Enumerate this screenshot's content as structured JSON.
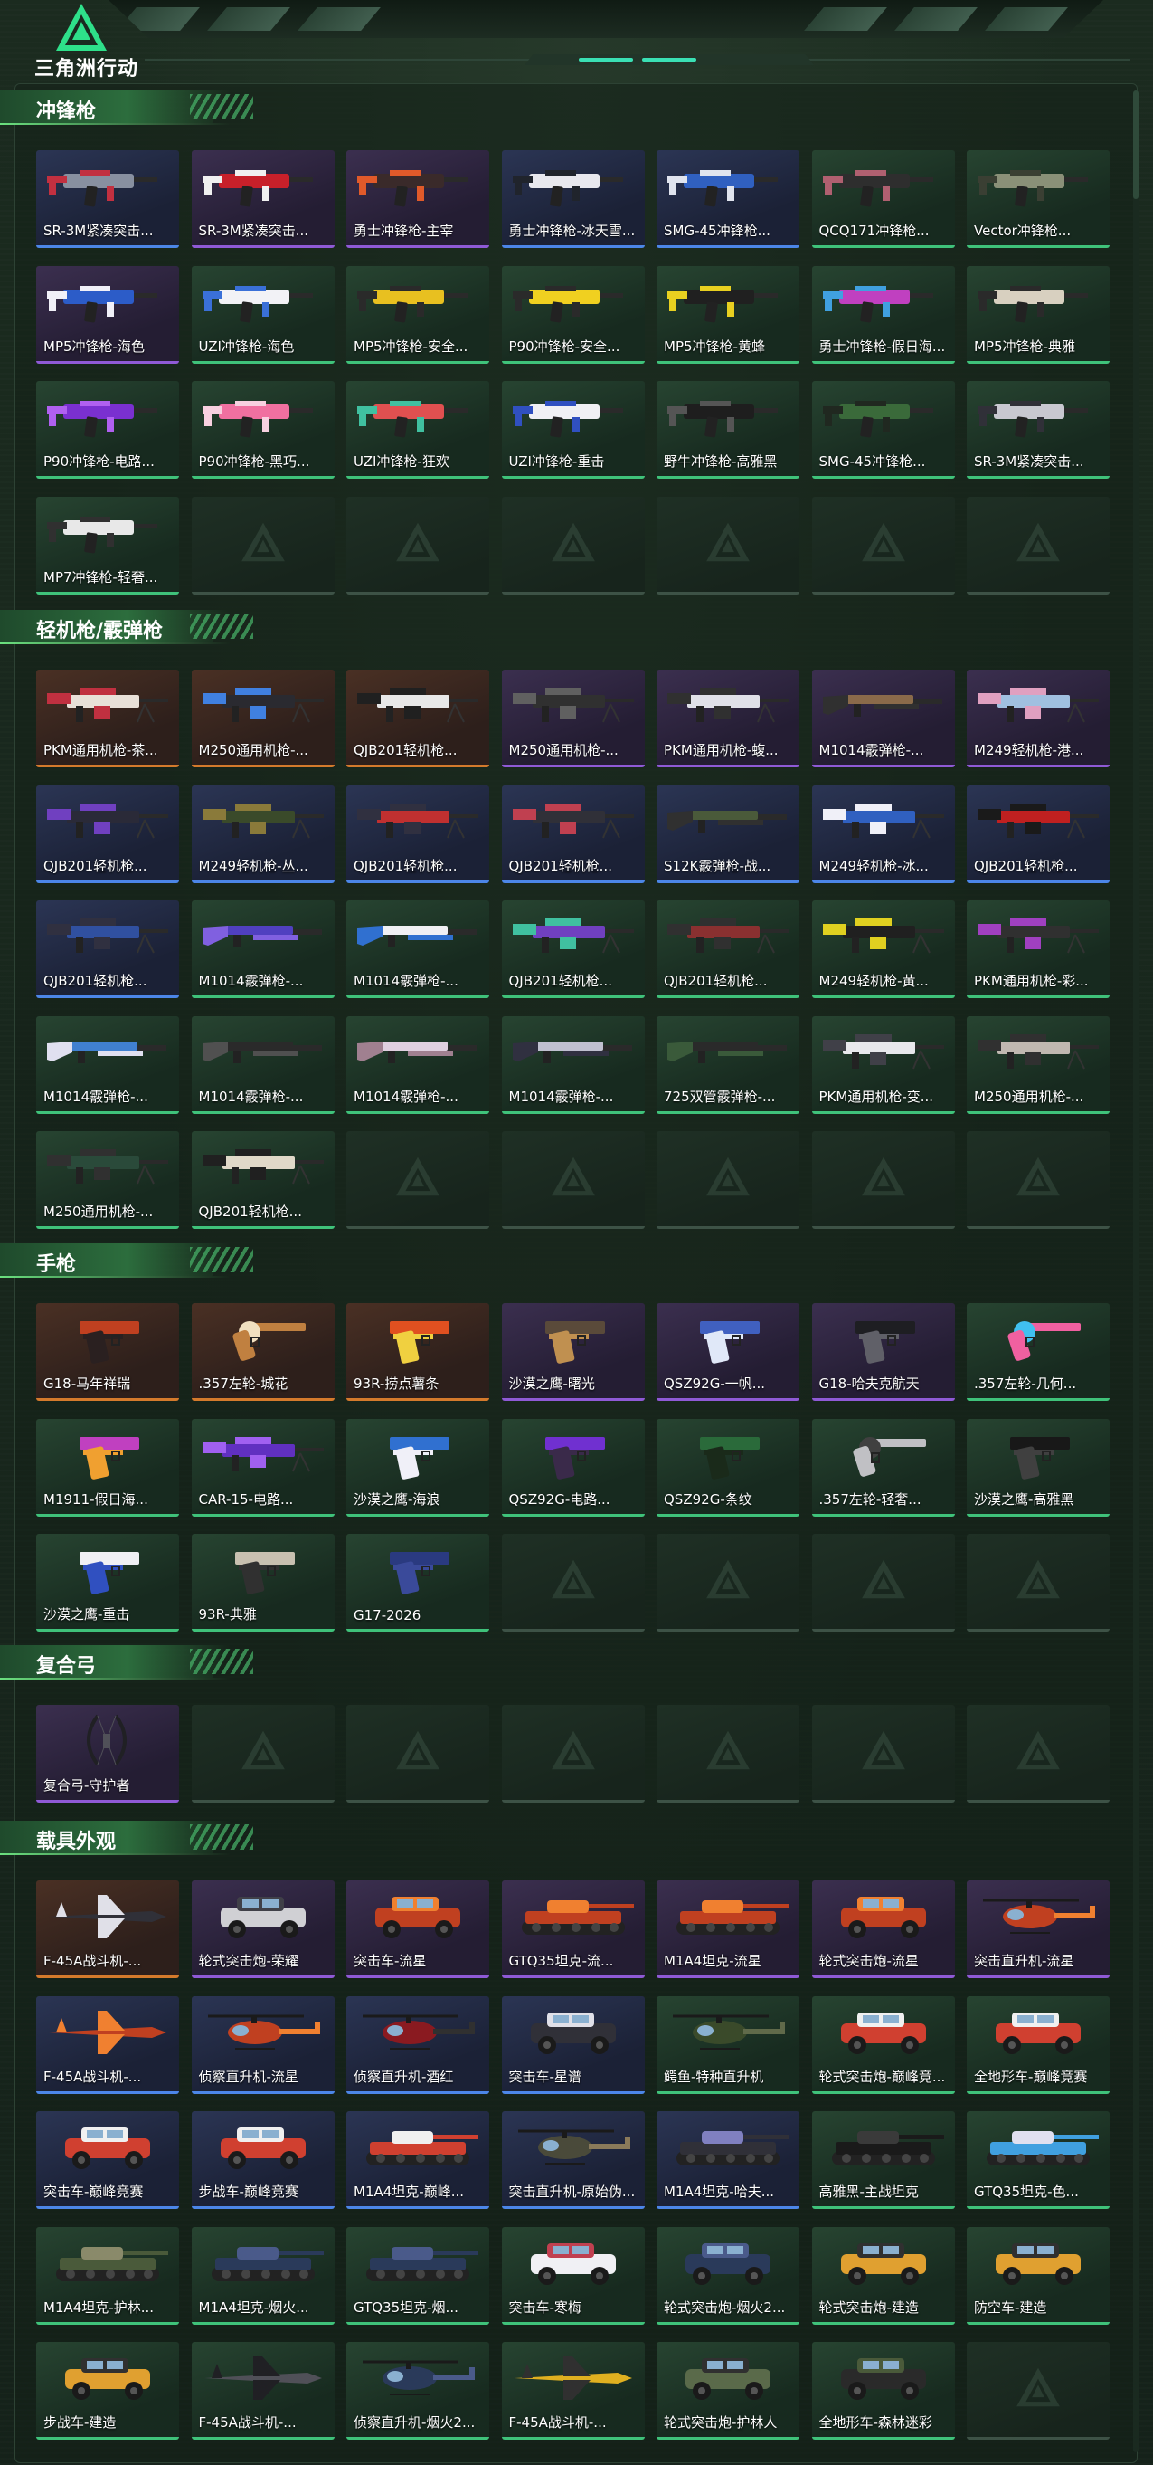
{
  "header": {
    "logo_text": "三角洲行动"
  },
  "colors": {
    "gold": "#d47a2c",
    "purple": "#8f5ad6",
    "blue": "#4c86e8",
    "green": "#3fc27a",
    "accent": "#6be07f"
  },
  "sections": [
    {
      "title": "冲锋枪",
      "category": "weapon",
      "items": [
        {
          "label": "SR-3M紧凑突击...",
          "rarity": "blue",
          "kind": "smg",
          "c1": "#8890a0",
          "c2": "#c23040"
        },
        {
          "label": "SR-3M紧凑突击...",
          "rarity": "purple",
          "kind": "smg",
          "c1": "#c8202a",
          "c2": "#f0f0f0"
        },
        {
          "label": "勇士冲锋枪-主宰",
          "rarity": "purple",
          "kind": "smg",
          "c1": "#3a2a2a",
          "c2": "#e05a2a"
        },
        {
          "label": "勇士冲锋枪-冰天雪...",
          "rarity": "blue",
          "kind": "smg",
          "c1": "#e8e8ee",
          "c2": "#20242c"
        },
        {
          "label": "SMG-45冲锋枪...",
          "rarity": "blue",
          "kind": "smg",
          "c1": "#3060c0",
          "c2": "#e0e4ee"
        },
        {
          "label": "QCQ171冲锋枪...",
          "rarity": "green",
          "kind": "smg",
          "c1": "#2e2e2e",
          "c2": "#b06070"
        },
        {
          "label": "Vector冲锋枪...",
          "rarity": "green",
          "kind": "smg",
          "c1": "#8a9078",
          "c2": "#3a3f33"
        },
        {
          "label": "MP5冲锋枪-海色",
          "rarity": "purple",
          "kind": "smg",
          "c1": "#2c5cc8",
          "c2": "#f0f0f8"
        },
        {
          "label": "UZI冲锋枪-海色",
          "rarity": "green",
          "kind": "smg",
          "c1": "#f2f2f6",
          "c2": "#3a70d8"
        },
        {
          "label": "MP5冲锋枪-安全...",
          "rarity": "green",
          "kind": "smg",
          "c1": "#e8c020",
          "c2": "#2a2a2a"
        },
        {
          "label": "P90冲锋枪-安全...",
          "rarity": "green",
          "kind": "smg",
          "c1": "#f0d020",
          "c2": "#2a2a2a"
        },
        {
          "label": "MP5冲锋枪-黄蜂",
          "rarity": "green",
          "kind": "smg",
          "c1": "#202020",
          "c2": "#e8d020"
        },
        {
          "label": "勇士冲锋枪-假日海...",
          "rarity": "green",
          "kind": "smg",
          "c1": "#c040c0",
          "c2": "#40a0e0"
        },
        {
          "label": "MP5冲锋枪-典雅",
          "rarity": "green",
          "kind": "smg",
          "c1": "#d8d0c0",
          "c2": "#2a2a2a"
        },
        {
          "label": "P90冲锋枪-电路...",
          "rarity": "green",
          "kind": "smg",
          "c1": "#7a30d0",
          "c2": "#b060f0"
        },
        {
          "label": "P90冲锋枪-黑巧...",
          "rarity": "green",
          "kind": "smg",
          "c1": "#f070a0",
          "c2": "#f8d0e0"
        },
        {
          "label": "UZI冲锋枪-狂欢",
          "rarity": "green",
          "kind": "smg",
          "c1": "#e05050",
          "c2": "#40c0a0"
        },
        {
          "label": "UZI冲锋枪-重击",
          "rarity": "green",
          "kind": "smg",
          "c1": "#f0f0f4",
          "c2": "#3050c0"
        },
        {
          "label": "野牛冲锋枪-高雅黑",
          "rarity": "green",
          "kind": "smg",
          "c1": "#1e1e1e",
          "c2": "#555555"
        },
        {
          "label": "SMG-45冲锋枪...",
          "rarity": "green",
          "kind": "smg",
          "c1": "#3a6a3a",
          "c2": "#202820"
        },
        {
          "label": "SR-3M紧凑突击...",
          "rarity": "green",
          "kind": "smg",
          "c1": "#c8c8d0",
          "c2": "#303038"
        },
        {
          "label": "MP7冲锋枪-轻奢...",
          "rarity": "green",
          "kind": "smg",
          "c1": "#e8e8e8",
          "c2": "#303030"
        },
        {
          "label": "",
          "rarity": "empty"
        },
        {
          "label": "",
          "rarity": "empty"
        },
        {
          "label": "",
          "rarity": "empty"
        },
        {
          "label": "",
          "rarity": "empty"
        },
        {
          "label": "",
          "rarity": "empty"
        },
        {
          "label": "",
          "rarity": "empty"
        }
      ]
    },
    {
      "title": "轻机枪/霰弹枪",
      "category": "weapon",
      "items": [
        {
          "label": "PKM通用机枪-茶...",
          "rarity": "gold",
          "kind": "lmg",
          "c1": "#e8e0d8",
          "c2": "#c03040"
        },
        {
          "label": "M250通用机枪-...",
          "rarity": "gold",
          "kind": "lmg",
          "c1": "#2a2a30",
          "c2": "#4080e0"
        },
        {
          "label": "QJB201轻机枪...",
          "rarity": "gold",
          "kind": "lmg",
          "c1": "#e8e8e8",
          "c2": "#202020"
        },
        {
          "label": "M250通用机枪-...",
          "rarity": "purple",
          "kind": "lmg",
          "c1": "#303030",
          "c2": "#606060"
        },
        {
          "label": "PKM通用机枪-蝮...",
          "rarity": "purple",
          "kind": "lmg",
          "c1": "#e0e0e8",
          "c2": "#303030"
        },
        {
          "label": "M1014霰弹枪-...",
          "rarity": "purple",
          "kind": "shotgun",
          "c1": "#8a6a4a",
          "c2": "#303030"
        },
        {
          "label": "M249轻机枪-港...",
          "rarity": "purple",
          "kind": "lmg",
          "c1": "#a0c0e0",
          "c2": "#e0a0c0"
        },
        {
          "label": "QJB201轻机枪...",
          "rarity": "blue",
          "kind": "lmg",
          "c1": "#2a2a38",
          "c2": "#7040c0"
        },
        {
          "label": "M249轻机枪-丛...",
          "rarity": "blue",
          "kind": "lmg",
          "c1": "#3a4a2a",
          "c2": "#8a7a3a"
        },
        {
          "label": "QJB201轻机枪...",
          "rarity": "blue",
          "kind": "lmg",
          "c1": "#c03030",
          "c2": "#303040"
        },
        {
          "label": "QJB201轻机枪...",
          "rarity": "blue",
          "kind": "lmg",
          "c1": "#303038",
          "c2": "#c04050"
        },
        {
          "label": "S12K霰弹枪-战...",
          "rarity": "blue",
          "kind": "shotgun",
          "c1": "#4a5a3a",
          "c2": "#303030"
        },
        {
          "label": "M249轻机枪-冰...",
          "rarity": "blue",
          "kind": "lmg",
          "c1": "#3060c0",
          "c2": "#f0f0f8"
        },
        {
          "label": "QJB201轻机枪...",
          "rarity": "blue",
          "kind": "lmg",
          "c1": "#c02020",
          "c2": "#1a1a1a"
        },
        {
          "label": "QJB201轻机枪...",
          "rarity": "blue",
          "kind": "lmg",
          "c1": "#3050a0",
          "c2": "#303040"
        },
        {
          "label": "M1014霰弹枪-...",
          "rarity": "green",
          "kind": "shotgun",
          "c1": "#5040c0",
          "c2": "#8060e0"
        },
        {
          "label": "M1014霰弹枪-...",
          "rarity": "green",
          "kind": "shotgun",
          "c1": "#f0f0f4",
          "c2": "#3070d0"
        },
        {
          "label": "QJB201轻机枪...",
          "rarity": "green",
          "kind": "lmg",
          "c1": "#7040c0",
          "c2": "#40c0a0"
        },
        {
          "label": "QJB201轻机枪...",
          "rarity": "green",
          "kind": "lmg",
          "c1": "#8a3030",
          "c2": "#303030"
        },
        {
          "label": "M249轻机枪-黄...",
          "rarity": "green",
          "kind": "lmg",
          "c1": "#202020",
          "c2": "#e0d020"
        },
        {
          "label": "PKM通用机枪-彩...",
          "rarity": "green",
          "kind": "lmg",
          "c1": "#303030",
          "c2": "#a040c0"
        },
        {
          "label": "M1014霰弹枪-...",
          "rarity": "green",
          "kind": "shotgun",
          "c1": "#4080d0",
          "c2": "#e0e0f0"
        },
        {
          "label": "M1014霰弹枪-...",
          "rarity": "green",
          "kind": "shotgun",
          "c1": "#2a2a2a",
          "c2": "#505050"
        },
        {
          "label": "M1014霰弹枪-...",
          "rarity": "green",
          "kind": "shotgun",
          "c1": "#e0d0e0",
          "c2": "#a08090"
        },
        {
          "label": "M1014霰弹枪-...",
          "rarity": "green",
          "kind": "shotgun",
          "c1": "#c0c0d0",
          "c2": "#303040"
        },
        {
          "label": "725双管霰弹枪-...",
          "rarity": "green",
          "kind": "shotgun",
          "c1": "#2a2a2a",
          "c2": "#3a5a3a"
        },
        {
          "label": "PKM通用机枪-变...",
          "rarity": "green",
          "kind": "lmg",
          "c1": "#e8e8ec",
          "c2": "#404048"
        },
        {
          "label": "M250通用机枪-...",
          "rarity": "green",
          "kind": "lmg",
          "c1": "#c0b8b0",
          "c2": "#303030"
        },
        {
          "label": "M250通用机枪-...",
          "rarity": "green",
          "kind": "lmg",
          "c1": "#2a4a3a",
          "c2": "#303030"
        },
        {
          "label": "QJB201轻机枪...",
          "rarity": "green",
          "kind": "lmg",
          "c1": "#e0d8c8",
          "c2": "#202020"
        },
        {
          "label": "",
          "rarity": "empty"
        },
        {
          "label": "",
          "rarity": "empty"
        },
        {
          "label": "",
          "rarity": "empty"
        },
        {
          "label": "",
          "rarity": "empty"
        },
        {
          "label": "",
          "rarity": "empty"
        }
      ]
    },
    {
      "title": "手枪",
      "category": "weapon",
      "items": [
        {
          "label": "G18-马年祥瑞",
          "rarity": "gold",
          "kind": "pistol",
          "c1": "#c04020",
          "c2": "#2a2020"
        },
        {
          "label": ".357左轮-城花",
          "rarity": "gold",
          "kind": "revolver",
          "c1": "#c08040",
          "c2": "#f0e0c0"
        },
        {
          "label": "93R-捞点薯条",
          "rarity": "gold",
          "kind": "pistol",
          "c1": "#e05020",
          "c2": "#f0d040"
        },
        {
          "label": "沙漠之鹰-曙光",
          "rarity": "purple",
          "kind": "pistol",
          "c1": "#5a4a3a",
          "c2": "#c09050"
        },
        {
          "label": "QSZ92G-一帆...",
          "rarity": "purple",
          "kind": "pistol",
          "c1": "#4060c0",
          "c2": "#e0e8f8"
        },
        {
          "label": "G18-哈夫克航天",
          "rarity": "purple",
          "kind": "pistol",
          "c1": "#1e1e22",
          "c2": "#606068"
        },
        {
          "label": ".357左轮-几何...",
          "rarity": "green",
          "kind": "revolver",
          "c1": "#f060a0",
          "c2": "#40c0f0"
        },
        {
          "label": "M1911-假日海...",
          "rarity": "green",
          "kind": "pistol",
          "c1": "#c040c0",
          "c2": "#f0a030"
        },
        {
          "label": "CAR-15-电路...",
          "rarity": "green",
          "kind": "lmg",
          "c1": "#6030c0",
          "c2": "#a060f0"
        },
        {
          "label": "沙漠之鹰-海浪",
          "rarity": "green",
          "kind": "pistol",
          "c1": "#3070d0",
          "c2": "#f0f0f8"
        },
        {
          "label": "QSZ92G-电路...",
          "rarity": "green",
          "kind": "pistol",
          "c1": "#7030d0",
          "c2": "#3a2a4a"
        },
        {
          "label": "QSZ92G-条纹",
          "rarity": "green",
          "kind": "pistol",
          "c1": "#2a6a3a",
          "c2": "#1a2a1a"
        },
        {
          "label": ".357左轮-轻奢...",
          "rarity": "green",
          "kind": "revolver",
          "c1": "#c0c0c4",
          "c2": "#404040"
        },
        {
          "label": "沙漠之鹰-高雅黑",
          "rarity": "green",
          "kind": "pistol",
          "c1": "#181818",
          "c2": "#404040"
        },
        {
          "label": "沙漠之鹰-重击",
          "rarity": "green",
          "kind": "pistol",
          "c1": "#f0f0f4",
          "c2": "#3050c0"
        },
        {
          "label": "93R-典雅",
          "rarity": "green",
          "kind": "pistol",
          "c1": "#c8c0b0",
          "c2": "#303030"
        },
        {
          "label": "G17-2026",
          "rarity": "green",
          "kind": "pistol",
          "c1": "#2a3a80",
          "c2": "#3a4a9a"
        },
        {
          "label": "",
          "rarity": "empty"
        },
        {
          "label": "",
          "rarity": "empty"
        },
        {
          "label": "",
          "rarity": "empty"
        },
        {
          "label": "",
          "rarity": "empty"
        }
      ]
    },
    {
      "title": "复合弓",
      "category": "weapon",
      "items": [
        {
          "label": "复合弓-守护者",
          "rarity": "purple",
          "kind": "bow",
          "c1": "#202024",
          "c2": "#505058"
        },
        {
          "label": "",
          "rarity": "empty"
        },
        {
          "label": "",
          "rarity": "empty"
        },
        {
          "label": "",
          "rarity": "empty"
        },
        {
          "label": "",
          "rarity": "empty"
        },
        {
          "label": "",
          "rarity": "empty"
        },
        {
          "label": "",
          "rarity": "empty"
        }
      ]
    },
    {
      "title": "载具外观",
      "category": "vehicle",
      "items": [
        {
          "label": "F-45A战斗机-...",
          "rarity": "gold",
          "kind": "jet",
          "c1": "#303038",
          "c2": "#e0e0e8"
        },
        {
          "label": "轮式突击炮-荣耀",
          "rarity": "purple",
          "kind": "car",
          "c1": "#d0d0d4",
          "c2": "#404048"
        },
        {
          "label": "突击车-流星",
          "rarity": "purple",
          "kind": "car",
          "c1": "#c04020",
          "c2": "#f08030"
        },
        {
          "label": "GTQ35坦克-流...",
          "rarity": "purple",
          "kind": "tank",
          "c1": "#c04020",
          "c2": "#f08030"
        },
        {
          "label": "M1A4坦克-流星",
          "rarity": "purple",
          "kind": "tank",
          "c1": "#c04020",
          "c2": "#f08030"
        },
        {
          "label": "轮式突击炮-流星",
          "rarity": "purple",
          "kind": "car",
          "c1": "#c04020",
          "c2": "#f08030"
        },
        {
          "label": "突击直升机-流星",
          "rarity": "purple",
          "kind": "heli",
          "c1": "#c04020",
          "c2": "#f08030"
        },
        {
          "label": "F-45A战斗机-...",
          "rarity": "blue",
          "kind": "jet",
          "c1": "#c04020",
          "c2": "#f08030"
        },
        {
          "label": "侦察直升机-流星",
          "rarity": "blue",
          "kind": "heli",
          "c1": "#c04020",
          "c2": "#f08030"
        },
        {
          "label": "侦察直升机-酒红",
          "rarity": "blue",
          "kind": "heli",
          "c1": "#8a1a20",
          "c2": "#303030"
        },
        {
          "label": "突击车-星谱",
          "rarity": "blue",
          "kind": "car",
          "c1": "#303038",
          "c2": "#e0e0e8"
        },
        {
          "label": "鳄鱼-特种直升机",
          "rarity": "green",
          "kind": "heli",
          "c1": "#3a4a2a",
          "c2": "#606a4a"
        },
        {
          "label": "轮式突击炮-巅峰竞...",
          "rarity": "green",
          "kind": "car",
          "c1": "#d04030",
          "c2": "#f0f0f0"
        },
        {
          "label": "全地形车-巅峰竞赛",
          "rarity": "green",
          "kind": "car",
          "c1": "#d04030",
          "c2": "#f0f0f0"
        },
        {
          "label": "突击车-巅峰竞赛",
          "rarity": "blue",
          "kind": "car",
          "c1": "#d04030",
          "c2": "#f0f0f0"
        },
        {
          "label": "步战车-巅峰竞赛",
          "rarity": "blue",
          "kind": "car",
          "c1": "#d04030",
          "c2": "#f0f0f0"
        },
        {
          "label": "M1A4坦克-巅峰...",
          "rarity": "blue",
          "kind": "tank",
          "c1": "#d04030",
          "c2": "#f0f0f0"
        },
        {
          "label": "突击直升机-原始伪...",
          "rarity": "blue",
          "kind": "heli",
          "c1": "#4a4a3a",
          "c2": "#8a7a5a"
        },
        {
          "label": "M1A4坦克-哈夫...",
          "rarity": "blue",
          "kind": "tank",
          "c1": "#303038",
          "c2": "#8080c0"
        },
        {
          "label": "高雅黑-主战坦克",
          "rarity": "green",
          "kind": "tank",
          "c1": "#1a1a1a",
          "c2": "#3a3a3a"
        },
        {
          "label": "GTQ35坦克-色...",
          "rarity": "green",
          "kind": "tank",
          "c1": "#40a0e0",
          "c2": "#e0e0f0"
        },
        {
          "label": "M1A4坦克-护林...",
          "rarity": "green",
          "kind": "tank",
          "c1": "#4a5a3a",
          "c2": "#8a8a6a"
        },
        {
          "label": "M1A4坦克-烟火...",
          "rarity": "green",
          "kind": "tank",
          "c1": "#2a3a5a",
          "c2": "#4a5a8a"
        },
        {
          "label": "GTQ35坦克-烟...",
          "rarity": "green",
          "kind": "tank",
          "c1": "#2a3a5a",
          "c2": "#4a5a8a"
        },
        {
          "label": "突击车-寒梅",
          "rarity": "green",
          "kind": "car",
          "c1": "#f0f0f4",
          "c2": "#c04050"
        },
        {
          "label": "轮式突击炮-烟火2...",
          "rarity": "green",
          "kind": "car",
          "c1": "#2a3a5a",
          "c2": "#4a5a8a"
        },
        {
          "label": "轮式突击炮-建造",
          "rarity": "green",
          "kind": "car",
          "c1": "#e0a030",
          "c2": "#303030"
        },
        {
          "label": "防空车-建造",
          "rarity": "green",
          "kind": "car",
          "c1": "#e0a030",
          "c2": "#303030"
        },
        {
          "label": "步战车-建造",
          "rarity": "green",
          "kind": "car",
          "c1": "#e0a030",
          "c2": "#303030"
        },
        {
          "label": "F-45A战斗机-...",
          "rarity": "green",
          "kind": "jet",
          "c1": "#505058",
          "c2": "#202024"
        },
        {
          "label": "侦察直升机-烟火2...",
          "rarity": "green",
          "kind": "heli",
          "c1": "#2a3a5a",
          "c2": "#4a5a8a"
        },
        {
          "label": "F-45A战斗机-...",
          "rarity": "green",
          "kind": "jet",
          "c1": "#e0b020",
          "c2": "#303030"
        },
        {
          "label": "轮式突击炮-护林人",
          "rarity": "green",
          "kind": "car",
          "c1": "#5a6a4a",
          "c2": "#303030"
        },
        {
          "label": "全地形车-森林迷彩",
          "rarity": "green",
          "kind": "car",
          "c1": "#2a2a2a",
          "c2": "#4a5a3a"
        },
        {
          "label": "",
          "rarity": "empty"
        }
      ]
    }
  ]
}
